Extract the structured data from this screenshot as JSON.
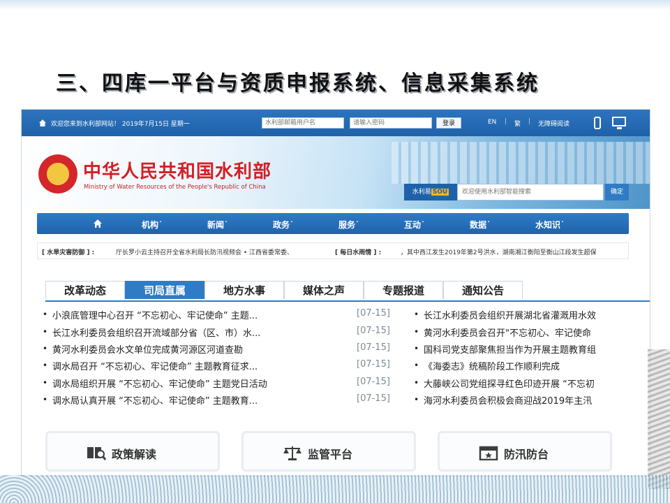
{
  "slide": {
    "title": "三、四库一平台与资质申报系统、信息采集系统"
  },
  "topbar": {
    "welcome": "欢迎您来到水利部网站！ 2019年7月15日 星期一",
    "username_placeholder": "水利部邮箱用户名",
    "password_placeholder": "请输入密码",
    "login_label": "登录",
    "lang_en": "EN",
    "lang_trad": "繁",
    "accessible": "无障碍阅读",
    "separator": "|"
  },
  "banner": {
    "title_cn": "中华人民共和国水利部",
    "title_en": "Ministry of Water Resources of the People's Republic of China",
    "search_brand": "水利易",
    "search_brand_sou": "SOU",
    "search_placeholder": "欢迎使用水利部智能搜索",
    "search_button": "确定"
  },
  "nav": {
    "items": [
      "机构˙",
      "新闻˙",
      "政务˙",
      "服务˙",
      "互动˙",
      "数据˙",
      "水知识˙"
    ]
  },
  "ticker": {
    "tag1": "[ 水旱灾害防御 ] :",
    "text1": "厅长罗小云主持召开全省水利局长防汛视频会   • 江西省委常委、",
    "tag2": "[ 每日水雨情 ] :",
    "text2": "，其中西江发生2019年第2号洪水，湖南湘江衡阳至衡山江段发生超保"
  },
  "tabs": [
    "改革动态",
    "司局直属",
    "地方水事",
    "媒体之声",
    "专题报道",
    "通知公告"
  ],
  "news_left": [
    {
      "title": "小浪底管理中心召开 “不忘初心、牢记使命” 主题...",
      "date": "[07-15]"
    },
    {
      "title": "长江水利委员会组织召开流域部分省（区、市）水...",
      "date": "[07-15]"
    },
    {
      "title": "黄河水利委员会水文单位完成黄河源区河道查勘",
      "date": "[07-15]"
    },
    {
      "title": "调水局召开 “不忘初心、牢记使命” 主题教育征求...",
      "date": "[07-15]"
    },
    {
      "title": "调水局组织开展 “不忘初心、牢记使命” 主题党日活动",
      "date": "[07-15]"
    },
    {
      "title": "调水局认真开展 “不忘初心、牢记使命” 主题教育...",
      "date": "[07-15]"
    }
  ],
  "news_right": [
    {
      "title": "长江水利委员会组织开展湖北省灌溉用水效"
    },
    {
      "title": "黄河水利委员会召开\"不忘初心、牢记使命"
    },
    {
      "title": "国科司党支部聚焦担当作为开展主题教育组"
    },
    {
      "title": "《海委志》统稿阶段工作顺利完成"
    },
    {
      "title": "大藤峡公司党组探寻红色印迹开展 “不忘初"
    },
    {
      "title": "海河水利委员会积极会商迎战2019年主汛"
    }
  ],
  "quick_links": [
    {
      "label": "政策解读",
      "icon": "book-search-icon"
    },
    {
      "label": "监管平台",
      "icon": "scale-icon"
    },
    {
      "label": "防汛防台",
      "icon": "calendar-star-icon"
    }
  ],
  "colors": {
    "brand_blue": "#1f62aa",
    "accent_blue": "#2f7cc4",
    "ministry_red": "#d41f26",
    "date_gray": "#7d8a96"
  }
}
